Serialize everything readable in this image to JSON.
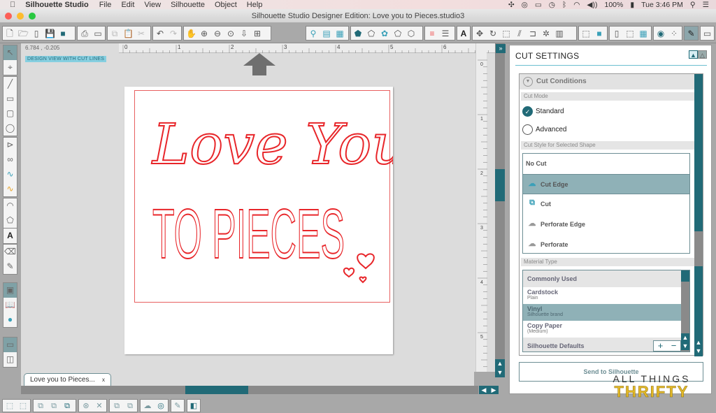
{
  "menubar": {
    "app": "Silhouette Studio",
    "items": [
      "File",
      "Edit",
      "View",
      "Silhouette",
      "Object",
      "Help"
    ],
    "battery": "100%",
    "clock": "Tue 3:46 PM"
  },
  "window": {
    "title": "Silhouette Studio Designer Edition: Love you to Pieces.studio3"
  },
  "canvas": {
    "coordinates": "6.784 , -0.205",
    "view_label": "DESIGN VIEW WITH CUT LINES",
    "ruler_ticks": [
      "0",
      "1",
      "2",
      "3",
      "4",
      "5",
      "6"
    ],
    "vruler_ticks": [
      "0",
      "1",
      "2",
      "3",
      "4",
      "5"
    ],
    "design_line1": "Love You",
    "design_line2": "TO PIECES"
  },
  "doc_tab": {
    "label": "Love you to Pieces...",
    "close": "x"
  },
  "panel": {
    "title": "CUT SETTINGS",
    "section": "Cut Conditions",
    "cut_mode_label": "Cut Mode",
    "modes": [
      {
        "label": "Standard",
        "selected": true
      },
      {
        "label": "Advanced",
        "selected": false
      }
    ],
    "cut_style_label": "Cut Style for Selected Shape",
    "cut_styles": [
      {
        "label": "No Cut",
        "icon": ""
      },
      {
        "label": "Cut Edge",
        "icon": "cut-edge-icon",
        "selected": true
      },
      {
        "label": "Cut",
        "icon": "cut-icon"
      },
      {
        "label": "Perforate Edge",
        "icon": "perforate-edge-icon"
      },
      {
        "label": "Perforate",
        "icon": "perforate-icon"
      }
    ],
    "material_label": "Material Type",
    "materials": [
      {
        "name": "Commonly Used",
        "sub": "",
        "type": "header"
      },
      {
        "name": "Cardstock",
        "sub": "Plain"
      },
      {
        "name": "Vinyl",
        "sub": "Silhouette brand",
        "selected": true
      },
      {
        "name": "Copy Paper",
        "sub": "(Medium)"
      },
      {
        "name": "Silhouette Defaults",
        "sub": "",
        "type": "header"
      }
    ],
    "send_button": "Send to Silhouette"
  },
  "watermark": {
    "line1": "ALL THINGS",
    "line2": "THRIFTY"
  },
  "colors": {
    "accent": "#216a77",
    "cut_line": "#e8262a",
    "selected_row": "#8fb1b7"
  }
}
